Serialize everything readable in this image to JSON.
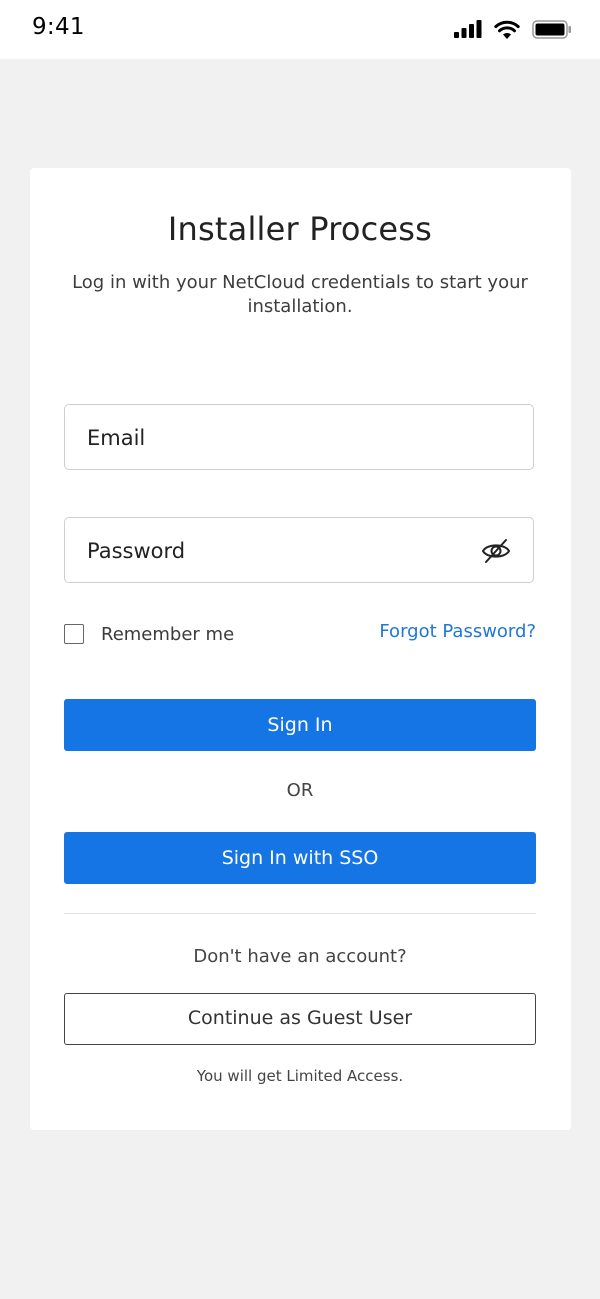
{
  "status_bar": {
    "time": "9:41",
    "icons": [
      "cellular-signal-icon",
      "wifi-icon",
      "battery-icon"
    ]
  },
  "login": {
    "title": "Installer Process",
    "subtitle": "Log in with your NetCloud credentials to start your installation.",
    "email_placeholder": "Email",
    "password_placeholder": "Password",
    "password_toggle_icon": "eye-slash-icon",
    "remember_label": "Remember me",
    "remember_checked": false,
    "forgot_label": "Forgot Password?",
    "signin_label": "Sign In",
    "or_label": "OR",
    "sso_label": "Sign In with SSO",
    "no_account_label": "Don't have an account?",
    "guest_label": "Continue as Guest User",
    "limited_access_note": "You will get Limited Access."
  },
  "colors": {
    "primary": "#1675e4",
    "link": "#1e77d6",
    "page_background": "#f1f1f1",
    "card_background": "#ffffff"
  }
}
